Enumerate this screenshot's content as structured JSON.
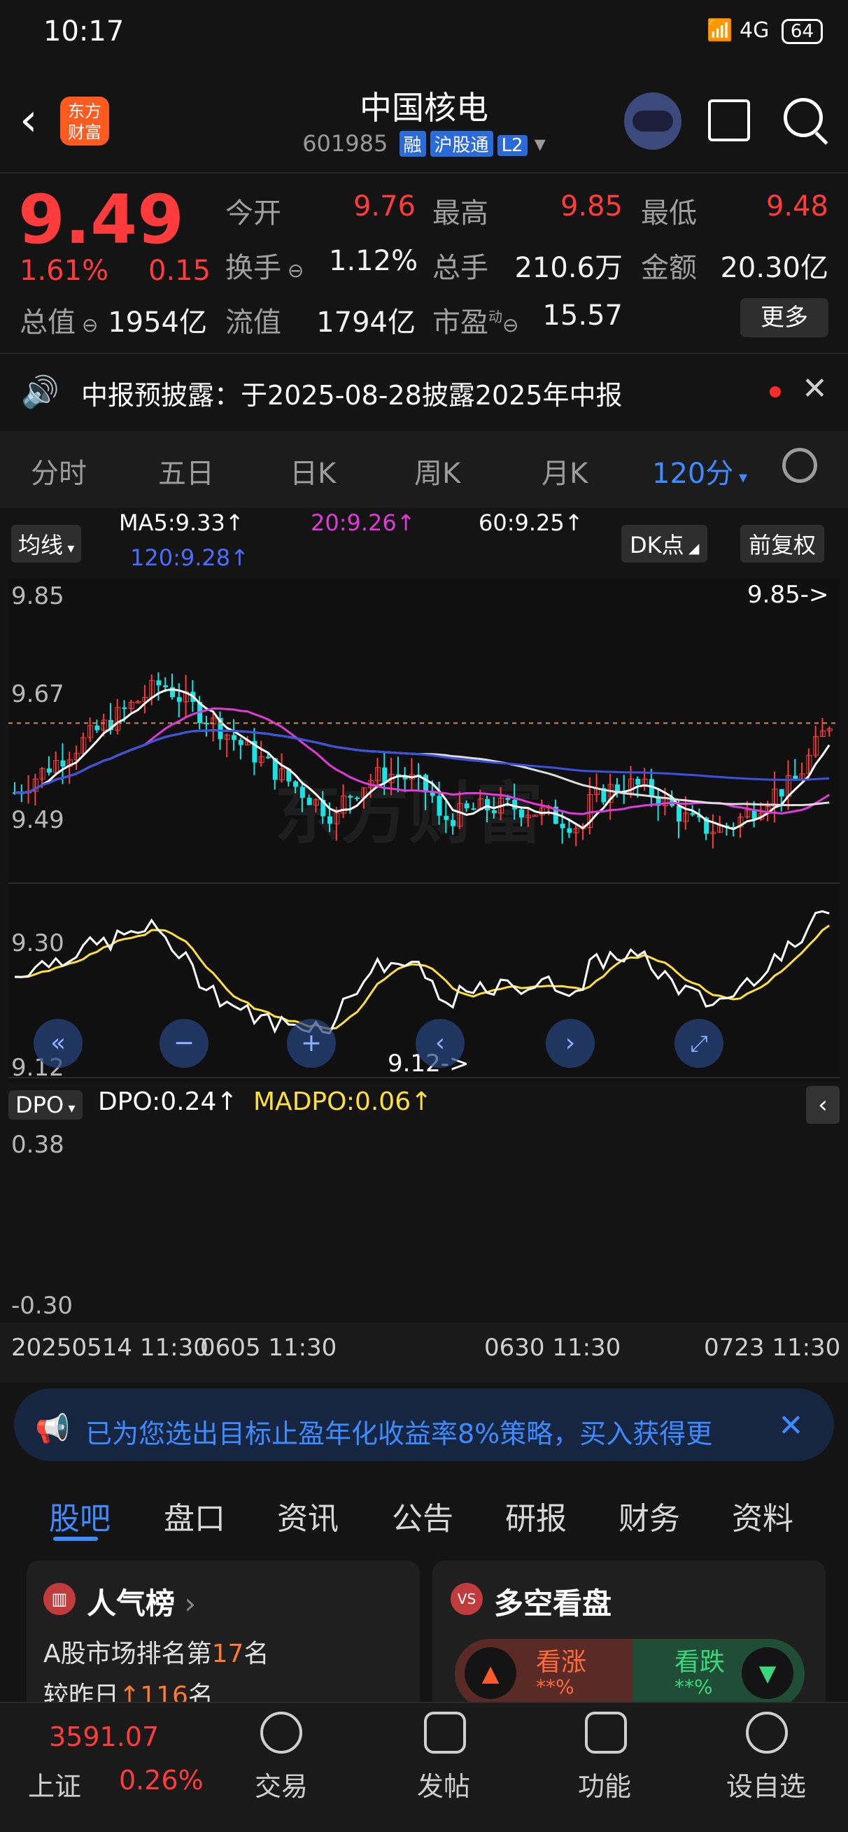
{
  "status_bar": {
    "time": "10:17",
    "network": "4G",
    "battery": "64"
  },
  "header": {
    "back_icon": "chevron-left-icon",
    "logo_text": "东方财富",
    "title": "中国核电",
    "code": "601985",
    "tags": [
      "融",
      "沪股通",
      "L2"
    ]
  },
  "quote": {
    "price": "9.49",
    "change_pct": "1.61%",
    "change": "0.15",
    "stats": [
      {
        "label": "今开",
        "value": "9.76"
      },
      {
        "label": "最高",
        "value": "9.85"
      },
      {
        "label": "最低",
        "value": "9.48"
      },
      {
        "label": "换手",
        "value": "1.12%"
      },
      {
        "label": "总手",
        "value": "210.6万"
      },
      {
        "label": "金额",
        "value": "20.30亿"
      },
      {
        "label": "总值",
        "value": "1954亿"
      },
      {
        "label": "流值",
        "value": "1794亿"
      },
      {
        "label": "市盈",
        "value": "15.57"
      }
    ],
    "pe_superscript": "动",
    "more_label": "更多"
  },
  "notice": {
    "text": "中报预披露：于2025-08-28披露2025年中报"
  },
  "period_tabs": [
    "分时",
    "五日",
    "日K",
    "周K",
    "月K",
    "120分"
  ],
  "active_period": "120分",
  "indicators": {
    "ma_button": "均线",
    "ma5": "MA5:9.33↑",
    "ma20": "20:9.26↑",
    "ma60": "60:9.25↑",
    "ma120": "120:9.28↑",
    "dk_button": "DK点",
    "adjust_button": "前复权",
    "dpo_button": "DPO",
    "dpo": "DPO:0.24↑",
    "madpo": "MADPO:0.06↑"
  },
  "chart_data": {
    "type": "candlestick",
    "watermark": "东方财富",
    "y_ticks": [
      "9.85",
      "9.67",
      "9.49",
      "9.30",
      "9.12"
    ],
    "ylim": [
      9.12,
      9.85
    ],
    "high_marker": "9.85->",
    "low_marker": "9.12->",
    "last_price_line": 9.49,
    "dpo_ticks": [
      "0.38",
      "-0.30"
    ],
    "x_labels": [
      "20250514 11:30",
      "0605 11:30",
      "0630 11:30",
      "0723 11:30"
    ],
    "colors": {
      "up": "#ff3b3b",
      "down": "#19e3e3",
      "ma5": "#ffffff",
      "ma20": "#e03ad8",
      "ma60": "#dcdcdc",
      "ma120": "#3b52e0",
      "madpo": "#ffe03a"
    }
  },
  "promo": {
    "text": "已为您选出目标止盈年化收益率8%策略，买入获得更"
  },
  "content_tabs": [
    "股吧",
    "盘口",
    "资讯",
    "公告",
    "研报",
    "财务",
    "资料"
  ],
  "cards": {
    "popularity": {
      "title": "人气榜",
      "line1_prefix": "A股市场排名第",
      "rank": "17",
      "line1_suffix": "名",
      "line2_prefix": "较昨日",
      "delta": "116",
      "line2_suffix": "名"
    },
    "bull_bear": {
      "title": "多空看盘",
      "bull": "看涨",
      "bear": "看跌",
      "masked": "**%"
    }
  },
  "bottom_nav": {
    "index_value": "3591.07",
    "index_name": "上证",
    "index_pct": "0.26%",
    "items": [
      "交易",
      "发帖",
      "功能",
      "设自选"
    ]
  }
}
